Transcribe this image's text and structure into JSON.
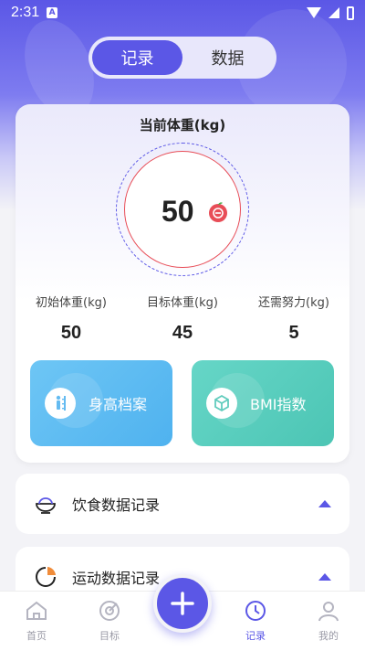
{
  "status_bar": {
    "time": "2:31",
    "notification_glyph": "A"
  },
  "tabs": [
    {
      "label": "记录",
      "active": true
    },
    {
      "label": "数据",
      "active": false
    }
  ],
  "weight_card": {
    "title": "当前体重(kg)",
    "current_weight": "50",
    "stats": [
      {
        "label": "初始体重(kg)",
        "value": "50"
      },
      {
        "label": "目标体重(kg)",
        "value": "45"
      },
      {
        "label": "还需努力(kg)",
        "value": "5"
      }
    ],
    "actions": [
      {
        "label": "身高档案",
        "icon": "height-ruler-icon",
        "color": "#5ab8f1"
      },
      {
        "label": "BMI指数",
        "icon": "bmi-box-icon",
        "color": "#58cdbd"
      }
    ]
  },
  "records": [
    {
      "label": "饮食数据记录",
      "icon": "food-bowl-icon"
    },
    {
      "label": "运动数据记录",
      "icon": "sport-pie-icon"
    }
  ],
  "bottom_nav": [
    {
      "label": "首页",
      "icon": "home-icon",
      "active": false
    },
    {
      "label": "目标",
      "icon": "target-icon",
      "active": false
    },
    {
      "label": "记录",
      "icon": "clock-icon",
      "active": true
    },
    {
      "label": "我的",
      "icon": "profile-icon",
      "active": false
    }
  ],
  "colors": {
    "primary": "#5b57e6",
    "ring_red": "#e84d57"
  }
}
